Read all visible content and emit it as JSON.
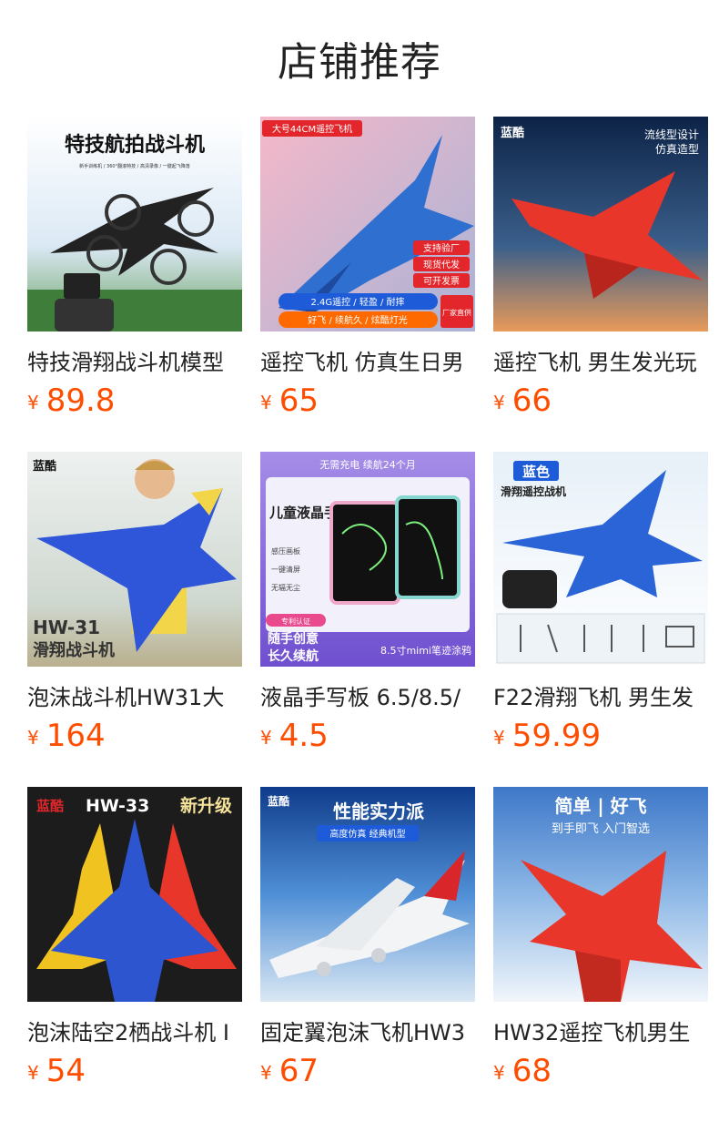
{
  "page_title": "店铺推荐",
  "currency": "¥",
  "products": [
    {
      "name": "特技滑翔战斗机模型",
      "price": "89.8",
      "thumb_text": [
        "特技航拍战斗机",
        "新手训练机 / 360°翻滚特技 / 高清录像 / 一键起飞降落"
      ]
    },
    {
      "name": "遥控飞机 仿真生日男",
      "price": "65",
      "thumb_text": [
        "大号44CM遥控飞机",
        "支持验厂",
        "现货代发",
        "可开发票",
        "2.4G遥控 / 轻盈 / 耐摔",
        "好飞 / 续航久 / 炫酷灯光",
        "厂家直供"
      ]
    },
    {
      "name": "遥控飞机 男生发光玩",
      "price": "66",
      "thumb_text": [
        "蓝酷",
        "流线型设计",
        "仿真造型"
      ]
    },
    {
      "name": "泡沫战斗机HW31大",
      "price": "164",
      "thumb_text": [
        "蓝酷",
        "HW-31",
        "滑翔战斗机"
      ]
    },
    {
      "name": "液晶手写板 6.5/8.5/",
      "price": "4.5",
      "thumb_text": [
        "无需充电 续航24个月",
        "儿童液晶手绘板",
        "感压画板",
        "一键清屏",
        "无辐无尘",
        "专利认证",
        "随手创意",
        "长久续航",
        "8.5寸mimi笔迹涂鸦"
      ]
    },
    {
      "name": "F22滑翔飞机 男生发",
      "price": "59.99",
      "thumb_text": [
        "蓝色",
        "滑翔遥控战机"
      ]
    },
    {
      "name": "泡沫陆空2栖战斗机 I",
      "price": "54",
      "thumb_text": [
        "蓝酷",
        "HW-33",
        "新升级"
      ]
    },
    {
      "name": "固定翼泡沫飞机HW3",
      "price": "67",
      "thumb_text": [
        "蓝酷",
        "性能实力派",
        "高度仿真 经典机型"
      ]
    },
    {
      "name": "HW32遥控飞机男生",
      "price": "68",
      "thumb_text": [
        "简单 | 好飞",
        "到手即飞 入门智选"
      ]
    }
  ],
  "colors": {
    "price": "#ff4d00",
    "title": "#222222"
  }
}
